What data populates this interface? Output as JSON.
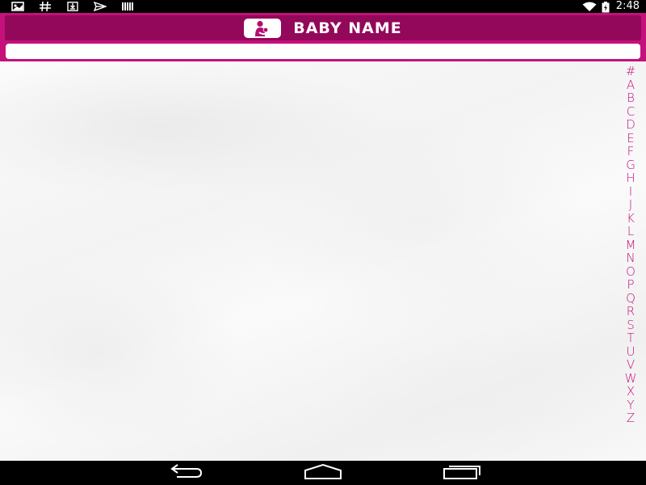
{
  "status_bar": {
    "time": "2:48",
    "left_icons": [
      "photo-icon",
      "hash-icon",
      "download-icon",
      "send-icon",
      "barcode-icon"
    ],
    "right_icons": [
      "wifi-icon",
      "battery-icon"
    ]
  },
  "header": {
    "title": "BABY NAME",
    "logo_icon": "mother-baby-icon",
    "search": {
      "value": "",
      "placeholder": ""
    }
  },
  "alphabet_index": [
    "#",
    "A",
    "B",
    "C",
    "D",
    "E",
    "F",
    "G",
    "H",
    "I",
    "J",
    "K",
    "L",
    "M",
    "N",
    "O",
    "P",
    "Q",
    "R",
    "S",
    "T",
    "U",
    "V",
    "W",
    "X",
    "Y",
    "Z"
  ],
  "navigation_bar": {
    "buttons": [
      "back-icon",
      "home-icon",
      "recent-apps-icon"
    ]
  },
  "colors": {
    "primary": "#c4117b",
    "primary_dark": "#93085a",
    "status_bar": "#000000",
    "text_on_primary": "#ffffff"
  }
}
